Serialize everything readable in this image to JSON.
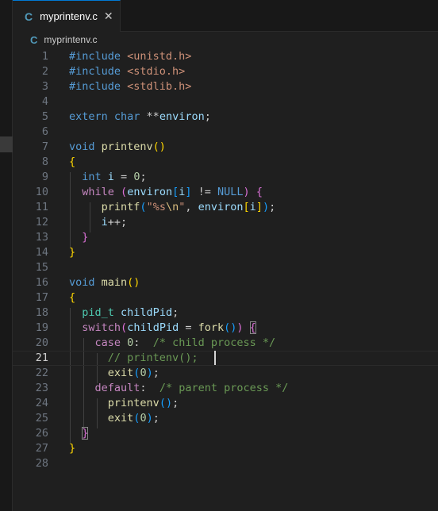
{
  "tab": {
    "icon": "C",
    "label": "myprintenv.c",
    "close_glyph": "✕"
  },
  "breadcrumb": {
    "icon": "C",
    "label": "myprintenv.c"
  },
  "editor": {
    "current_line": 21,
    "lines": [
      {
        "n": "1",
        "tokens": [
          [
            "kw",
            "#include "
          ],
          [
            "str",
            "<unistd.h>"
          ]
        ]
      },
      {
        "n": "2",
        "tokens": [
          [
            "kw",
            "#include "
          ],
          [
            "str",
            "<stdio.h>"
          ]
        ]
      },
      {
        "n": "3",
        "tokens": [
          [
            "kw",
            "#include "
          ],
          [
            "str",
            "<stdlib.h>"
          ]
        ]
      },
      {
        "n": "4",
        "tokens": []
      },
      {
        "n": "5",
        "tokens": [
          [
            "kw",
            "extern char "
          ],
          [
            "",
            "**"
          ],
          [
            "var",
            "environ"
          ],
          [
            "",
            ";"
          ]
        ]
      },
      {
        "n": "6",
        "tokens": []
      },
      {
        "n": "7",
        "tokens": [
          [
            "kw",
            "void "
          ],
          [
            "fn",
            "printenv"
          ],
          [
            "b1",
            "()"
          ]
        ]
      },
      {
        "n": "8",
        "tokens": [
          [
            "b1",
            "{"
          ]
        ]
      },
      {
        "n": "9",
        "tokens": [
          [
            "",
            "  "
          ],
          [
            "kw",
            "int "
          ],
          [
            "var",
            "i"
          ],
          [
            "",
            " = "
          ],
          [
            "num",
            "0"
          ],
          [
            "",
            ";"
          ]
        ]
      },
      {
        "n": "10",
        "tokens": [
          [
            "",
            "  "
          ],
          [
            "ctl",
            "while "
          ],
          [
            "b2",
            "("
          ],
          [
            "var",
            "environ"
          ],
          [
            "b3",
            "["
          ],
          [
            "var",
            "i"
          ],
          [
            "b3",
            "]"
          ],
          [
            "",
            " != "
          ],
          [
            "kw",
            "NULL"
          ],
          [
            "b2",
            ")"
          ],
          [
            "",
            " "
          ],
          [
            "b2",
            "{"
          ]
        ]
      },
      {
        "n": "11",
        "tokens": [
          [
            "",
            "     "
          ],
          [
            "fn",
            "printf"
          ],
          [
            "b3",
            "("
          ],
          [
            "str",
            "\"%s"
          ],
          [
            "esc",
            "\\n"
          ],
          [
            "str",
            "\""
          ],
          [
            "",
            ", "
          ],
          [
            "var",
            "environ"
          ],
          [
            "b1",
            "["
          ],
          [
            "var",
            "i"
          ],
          [
            "b1",
            "]"
          ],
          [
            "b3",
            ")"
          ],
          [
            "",
            ";"
          ]
        ]
      },
      {
        "n": "12",
        "tokens": [
          [
            "",
            "     "
          ],
          [
            "var",
            "i"
          ],
          [
            "",
            "++;"
          ]
        ]
      },
      {
        "n": "13",
        "tokens": [
          [
            "",
            "  "
          ],
          [
            "b2",
            "}"
          ]
        ]
      },
      {
        "n": "14",
        "tokens": [
          [
            "b1",
            "}"
          ]
        ]
      },
      {
        "n": "15",
        "tokens": []
      },
      {
        "n": "16",
        "tokens": [
          [
            "kw",
            "void "
          ],
          [
            "fn",
            "main"
          ],
          [
            "b1",
            "()"
          ]
        ]
      },
      {
        "n": "17",
        "tokens": [
          [
            "b1",
            "{"
          ]
        ]
      },
      {
        "n": "18",
        "tokens": [
          [
            "",
            "  "
          ],
          [
            "type",
            "pid_t "
          ],
          [
            "var",
            "childPid"
          ],
          [
            "",
            ";"
          ]
        ]
      },
      {
        "n": "19",
        "tokens": [
          [
            "",
            "  "
          ],
          [
            "ctl",
            "switch"
          ],
          [
            "b2",
            "("
          ],
          [
            "var",
            "childPid"
          ],
          [
            "",
            " = "
          ],
          [
            "fn",
            "fork"
          ],
          [
            "b3",
            "()"
          ],
          [
            "b2",
            ")"
          ],
          [
            "",
            " "
          ],
          [
            "b2 br-match",
            "{"
          ]
        ]
      },
      {
        "n": "20",
        "tokens": [
          [
            "",
            "    "
          ],
          [
            "ctl",
            "case "
          ],
          [
            "num",
            "0"
          ],
          [
            "",
            ":  "
          ],
          [
            "cmt",
            "/* child process */"
          ]
        ]
      },
      {
        "n": "21",
        "tokens": [
          [
            "",
            "      "
          ],
          [
            "cmt",
            "// printenv();"
          ]
        ]
      },
      {
        "n": "22",
        "tokens": [
          [
            "",
            "      "
          ],
          [
            "fn",
            "exit"
          ],
          [
            "b3",
            "("
          ],
          [
            "num",
            "0"
          ],
          [
            "b3",
            ")"
          ],
          [
            "",
            ";"
          ]
        ]
      },
      {
        "n": "23",
        "tokens": [
          [
            "",
            "    "
          ],
          [
            "ctl",
            "default"
          ],
          [
            "",
            ":  "
          ],
          [
            "cmt",
            "/* parent process */"
          ]
        ]
      },
      {
        "n": "24",
        "tokens": [
          [
            "",
            "      "
          ],
          [
            "fn",
            "printenv"
          ],
          [
            "b3",
            "()"
          ],
          [
            "",
            ";"
          ]
        ]
      },
      {
        "n": "25",
        "tokens": [
          [
            "",
            "      "
          ],
          [
            "fn",
            "exit"
          ],
          [
            "b3",
            "("
          ],
          [
            "num",
            "0"
          ],
          [
            "b3",
            ")"
          ],
          [
            "",
            ";"
          ]
        ]
      },
      {
        "n": "26",
        "tokens": [
          [
            "",
            "  "
          ],
          [
            "b2 br-match",
            "}"
          ]
        ]
      },
      {
        "n": "27",
        "tokens": [
          [
            "b1",
            "}"
          ]
        ]
      },
      {
        "n": "28",
        "tokens": []
      }
    ]
  }
}
